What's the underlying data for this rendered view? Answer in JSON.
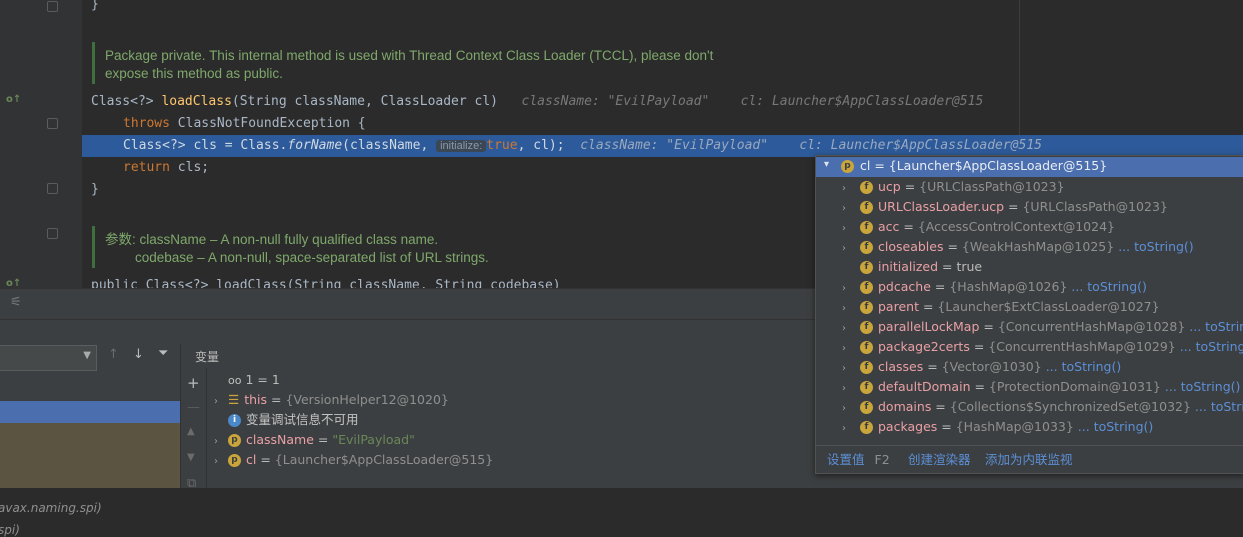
{
  "editor": {
    "closing_brace_top": "}",
    "doc1_line1": "Package private. This internal method is used with Thread Context Class Loader (TCCL), please don't",
    "doc1_line2": "expose this method as public.",
    "sig_class": "Class<?> ",
    "sig_method": "loadClass",
    "sig_params": "(String className, ClassLoader cl)",
    "sig_hint": "className: \"EvilPayload\"    cl: Launcher$AppClassLoader@515",
    "throws_kw": "throws",
    "throws_rest": " ClassNotFoundException {",
    "cur_prefix": "Class<?> cls = Class.",
    "cur_method": "forName",
    "cur_args1": "(className, ",
    "cur_inlay": "initialize:",
    "cur_true": "true",
    "cur_args2": ", cl);",
    "cur_hint": "className: \"EvilPayload\"    cl: Launcher$AppClassLoader@515",
    "return_kw": "return",
    "return_rest": " cls;",
    "closing_brace": "}",
    "doc2_line1": "参数: className – A non-null fully qualified class name.",
    "doc2_line2": "        codebase – A non-null, space-separated list of URL strings.",
    "next_line": "public Class<?> loadClass(String className, String codebase)"
  },
  "debug": {
    "variables_title": "变量",
    "frames_partial_1": "avax.naming.spi)",
    "frames_partial_2": "spi)",
    "variables": [
      {
        "arrow": "",
        "icon": "watch-icon",
        "name": "1",
        "eq": " = ",
        "value": "1"
      },
      {
        "arrow": "›",
        "icon": "list-icon",
        "name": "this",
        "eq": " = ",
        "value": "{VersionHelper12@1020}"
      },
      {
        "arrow": "",
        "icon": "info-icon",
        "name": "变量调试信息不可用",
        "eq": "",
        "value": ""
      },
      {
        "arrow": "›",
        "icon": "param-icon",
        "name": "className",
        "eq": " = ",
        "value": "\"EvilPayload\""
      },
      {
        "arrow": "›",
        "icon": "param-icon",
        "name": "cl",
        "eq": " = ",
        "value": "{Launcher$AppClassLoader@515}"
      }
    ]
  },
  "popup": {
    "header": "cl = {Launcher$AppClassLoader@515}",
    "rows": [
      {
        "name": "ucp",
        "value": "{URLClassPath@1023}",
        "link": ""
      },
      {
        "name": "URLClassLoader.ucp",
        "value": "{URLClassPath@1023}",
        "link": ""
      },
      {
        "name": "acc",
        "value": "{AccessControlContext@1024}",
        "link": ""
      },
      {
        "name": "closeables",
        "value": "{WeakHashMap@1025}",
        "link": "... toString()"
      },
      {
        "name": "initialized",
        "value": "true",
        "link": ""
      },
      {
        "name": "pdcache",
        "value": "{HashMap@1026}",
        "link": "... toString()"
      },
      {
        "name": "parent",
        "value": "{Launcher$ExtClassLoader@1027}",
        "link": ""
      },
      {
        "name": "parallelLockMap",
        "value": "{ConcurrentHashMap@1028}",
        "link": "... toString()"
      },
      {
        "name": "package2certs",
        "value": "{ConcurrentHashMap@1029}",
        "link": "... toString()"
      },
      {
        "name": "classes",
        "value": "{Vector@1030}",
        "link": "... toString()"
      },
      {
        "name": "defaultDomain",
        "value": "{ProtectionDomain@1031}",
        "link": "... toString()"
      },
      {
        "name": "domains",
        "value": "{Collections$SynchronizedSet@1032}",
        "link": "... toString()"
      },
      {
        "name": "packages",
        "value": "{HashMap@1033}",
        "link": "... toString()"
      }
    ],
    "footer": {
      "set_value": "设置值",
      "set_value_key": "F2",
      "create_renderer": "创建渲染器",
      "add_inline_watch": "添加为内联监视"
    }
  }
}
